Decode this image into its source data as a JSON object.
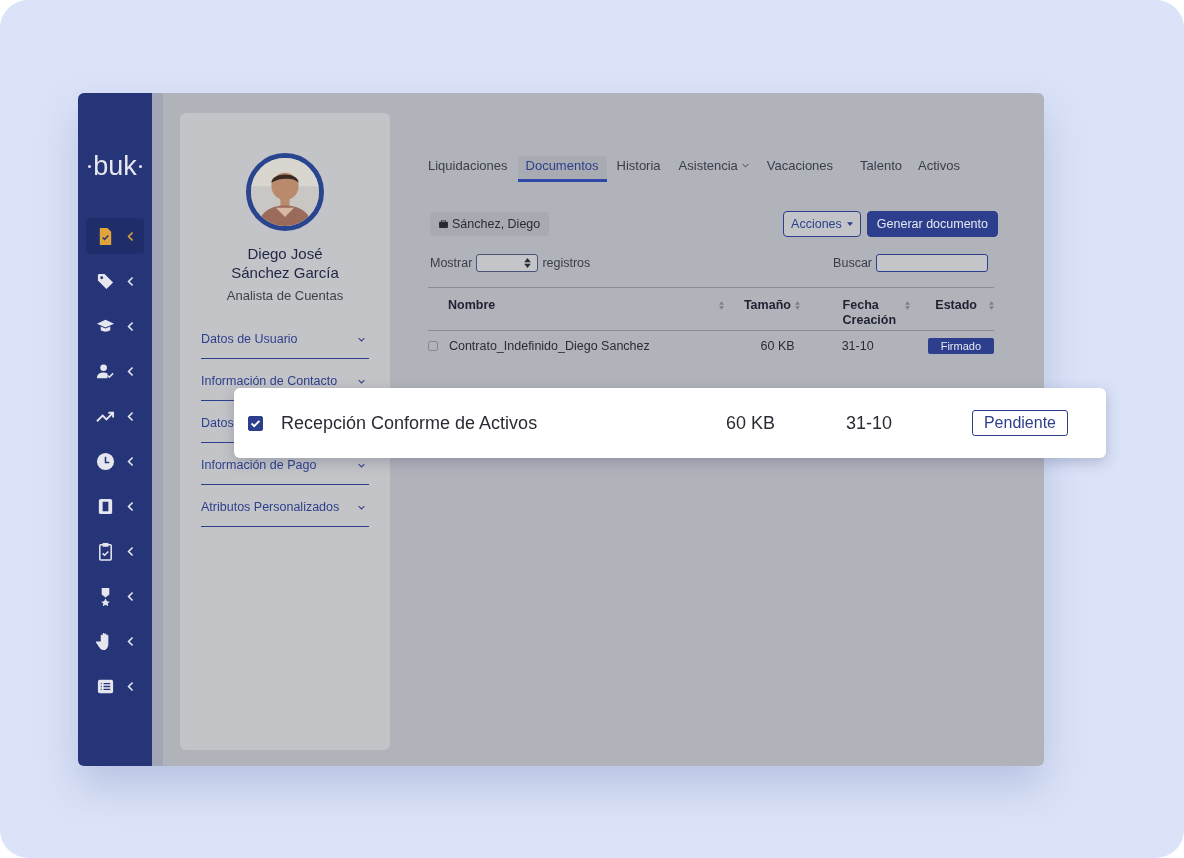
{
  "sidebar": {
    "logo": "buk",
    "items": [
      {
        "selected": true
      },
      {
        "selected": false
      },
      {
        "selected": false
      },
      {
        "selected": false
      },
      {
        "selected": false
      },
      {
        "selected": false
      },
      {
        "selected": false
      },
      {
        "selected": false
      },
      {
        "selected": false
      },
      {
        "selected": false
      },
      {
        "selected": false
      }
    ]
  },
  "profile": {
    "name_lines": [
      "Diego José",
      "Sánchez García"
    ],
    "role": "Analista de Cuentas",
    "sections": [
      {
        "label": "Datos de Usuario"
      },
      {
        "label": "Información de Contacto"
      },
      {
        "label": "Datos"
      },
      {
        "label": "Información de Pago"
      },
      {
        "label": "Atributos Personalizados"
      }
    ]
  },
  "tabs": [
    {
      "label": "Liquidaciones",
      "selected": false,
      "dropdown": false
    },
    {
      "label": "Documentos",
      "selected": true,
      "dropdown": false
    },
    {
      "label": "Historia",
      "selected": false,
      "dropdown": false
    },
    {
      "label": "Asistencia",
      "selected": false,
      "dropdown": true
    },
    {
      "label": "Vacaciones",
      "selected": false,
      "dropdown": false
    },
    {
      "label": "Talento",
      "selected": false,
      "dropdown": false
    },
    {
      "label": "Activos",
      "selected": false,
      "dropdown": false
    }
  ],
  "employee_chip": "Sánchez, Diego",
  "buttons": [
    {
      "label": "Acciones",
      "kind": "outline"
    },
    {
      "label": "Generar documento",
      "kind": "primary"
    }
  ],
  "show_label": "Mostrar",
  "records_label": "registros",
  "search_label": "Buscar",
  "table": {
    "columns": [
      "Nombre",
      "Tamaño",
      "Fecha Creación",
      "Estado"
    ],
    "rows": [
      {
        "checked": false,
        "name": "Contrato_Indefinido_Diego Sanchez",
        "size": "60 KB",
        "date": "31-10",
        "status": {
          "text": "Firmado",
          "kind": "filled"
        }
      }
    ]
  },
  "highlight_row": {
    "checked": true,
    "name": "Recepción Conforme de Activos",
    "size": "60 KB",
    "date": "31-10",
    "status": {
      "text": "Pendiente",
      "kind": "outline"
    }
  }
}
